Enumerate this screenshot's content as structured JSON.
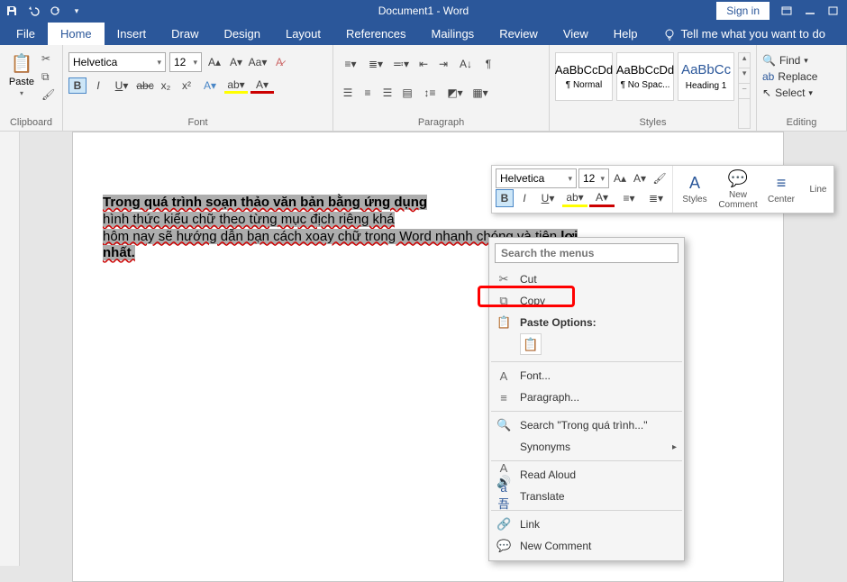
{
  "title": "Document1 - Word",
  "signin": "Sign in",
  "tabs": {
    "file": "File",
    "home": "Home",
    "insert": "Insert",
    "draw": "Draw",
    "design": "Design",
    "layout": "Layout",
    "references": "References",
    "mailings": "Mailings",
    "review": "Review",
    "view": "View",
    "help": "Help",
    "tellme": "Tell me what you want to do"
  },
  "ribbon": {
    "clipboard": {
      "label": "Clipboard",
      "paste": "Paste"
    },
    "font": {
      "label": "Font",
      "family": "Helvetica",
      "size": "12"
    },
    "paragraph": {
      "label": "Paragraph"
    },
    "styles": {
      "label": "Styles",
      "normal_prev": "AaBbCcDd",
      "normal": "¶ Normal",
      "nospac_prev": "AaBbCcDd",
      "nospac": "¶ No Spac...",
      "h1_prev": "AaBbCc",
      "h1": "Heading 1"
    },
    "editing": {
      "label": "Editing",
      "find": "Find",
      "replace": "Replace",
      "select": "Select"
    }
  },
  "mini": {
    "font": "Helvetica",
    "size": "12",
    "styles": "Styles",
    "newcomment": "New\nComment",
    "center": "Center",
    "line": "Line"
  },
  "doc": {
    "line1": "Trong quá trình soạn thảo văn bản bằng ứng dụng",
    "line2": "hình thức kiểu chữ theo từng mục địch riêng khá",
    "line3": "hôm nay sẽ hướng dẫn bạn cách xoay chữ trong Word nhanh chóng và tiện ",
    "line3b": "lợi",
    "line4": "nhất."
  },
  "ctx": {
    "search_ph": "Search the menus",
    "cut": "Cut",
    "copy": "Copy",
    "pasteopts": "Paste Options:",
    "font": "Font...",
    "paragraph": "Paragraph...",
    "search": "Search \"Trong quá trình...\"",
    "synonyms": "Synonyms",
    "readaloud": "Read Aloud",
    "translate": "Translate",
    "link": "Link",
    "newcomment": "New Comment"
  }
}
